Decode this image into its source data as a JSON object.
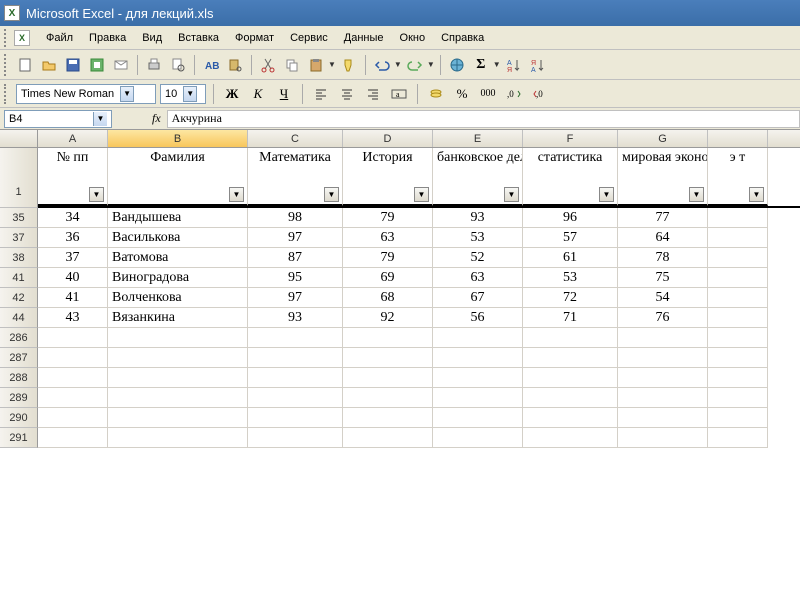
{
  "title": "Microsoft Excel - для лекций.xls",
  "menu": [
    "Файл",
    "Правка",
    "Вид",
    "Вставка",
    "Формат",
    "Сервис",
    "Данные",
    "Окно",
    "Справка"
  ],
  "font": {
    "name": "Times New Roman",
    "size": "10"
  },
  "nameBox": "B4",
  "fxLabel": "fx",
  "formula": "Акчурина",
  "columns": [
    "A",
    "B",
    "C",
    "D",
    "E",
    "F",
    "G",
    ""
  ],
  "selectedCol": "B",
  "headerRow": {
    "rownum": "1",
    "labels": {
      "A": "№ пп",
      "B": "Фамилия",
      "C": "Математика",
      "D": "История",
      "E": "банковское дело",
      "F": "статистика",
      "G": "мировая экономика",
      "H": "э т"
    }
  },
  "rows": [
    {
      "r": "35",
      "cells": [
        "34",
        "Вандышева",
        "98",
        "79",
        "93",
        "96",
        "77"
      ]
    },
    {
      "r": "37",
      "cells": [
        "36",
        "Василькова",
        "97",
        "63",
        "53",
        "57",
        "64"
      ]
    },
    {
      "r": "38",
      "cells": [
        "37",
        "Ватомова",
        "87",
        "79",
        "52",
        "61",
        "78"
      ]
    },
    {
      "r": "41",
      "cells": [
        "40",
        "Виноградова",
        "95",
        "69",
        "63",
        "53",
        "75"
      ]
    },
    {
      "r": "42",
      "cells": [
        "41",
        "Волченкова",
        "97",
        "68",
        "67",
        "72",
        "54"
      ]
    },
    {
      "r": "44",
      "cells": [
        "43",
        "Вязанкина",
        "93",
        "92",
        "56",
        "71",
        "76"
      ]
    }
  ],
  "emptyRows": [
    "286",
    "287",
    "288",
    "289",
    "290",
    "291"
  ],
  "icons": {
    "sigma": "Σ"
  }
}
